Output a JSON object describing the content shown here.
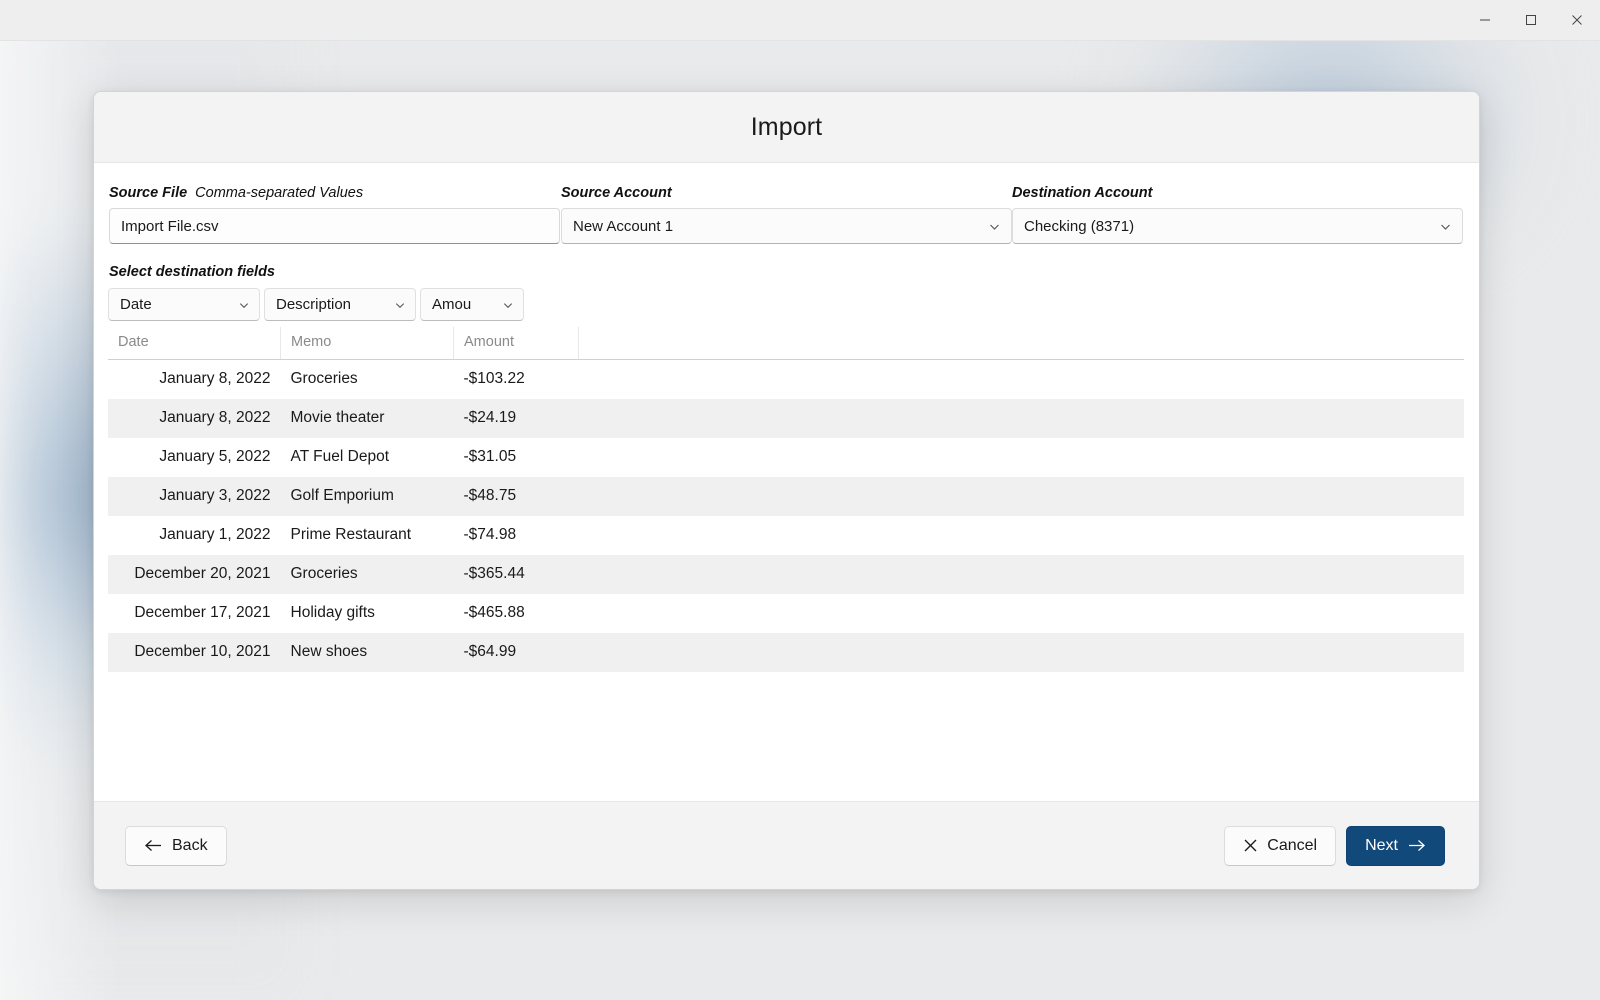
{
  "window": {
    "caption_buttons": [
      {
        "name": "minimize",
        "icon": "minimize-icon"
      },
      {
        "name": "maximize",
        "icon": "maximize-icon"
      },
      {
        "name": "close",
        "icon": "close-icon"
      }
    ]
  },
  "dialog": {
    "title": "Import"
  },
  "fields": {
    "source_file": {
      "label": "Source File",
      "sublabel": "Comma-separated Values",
      "value": "Import File.csv"
    },
    "source_account": {
      "label": "Source Account",
      "value": "New Account 1"
    },
    "destination_account": {
      "label": "Destination Account",
      "value": "Checking (8371)"
    }
  },
  "mapping": {
    "section_label": "Select destination fields",
    "selects": [
      {
        "value": "Date"
      },
      {
        "value": "Description"
      },
      {
        "value": "Amou"
      }
    ]
  },
  "table": {
    "headers": [
      "Date",
      "Memo",
      "Amount"
    ],
    "rows": [
      {
        "date": "January 8, 2022",
        "memo": "Groceries",
        "amount": "-$103.22"
      },
      {
        "date": "January 8, 2022",
        "memo": "Movie theater",
        "amount": "-$24.19"
      },
      {
        "date": "January 5, 2022",
        "memo": "AT Fuel Depot",
        "amount": "-$31.05"
      },
      {
        "date": "January 3, 2022",
        "memo": "Golf Emporium",
        "amount": "-$48.75"
      },
      {
        "date": "January 1, 2022",
        "memo": "Prime Restaurant",
        "amount": "-$74.98"
      },
      {
        "date": "December 20, 2021",
        "memo": "Groceries",
        "amount": "-$365.44"
      },
      {
        "date": "December 17, 2021",
        "memo": "Holiday gifts",
        "amount": "-$465.88"
      },
      {
        "date": "December 10, 2021",
        "memo": "New shoes",
        "amount": "-$64.99"
      }
    ]
  },
  "footer": {
    "back_label": "Back",
    "cancel_label": "Cancel",
    "next_label": "Next"
  },
  "colors": {
    "primary": "#11497a",
    "titlebar": "#eeeeee",
    "header_band": "#f3f3f3",
    "row_stripe": "#f0f0f0"
  }
}
